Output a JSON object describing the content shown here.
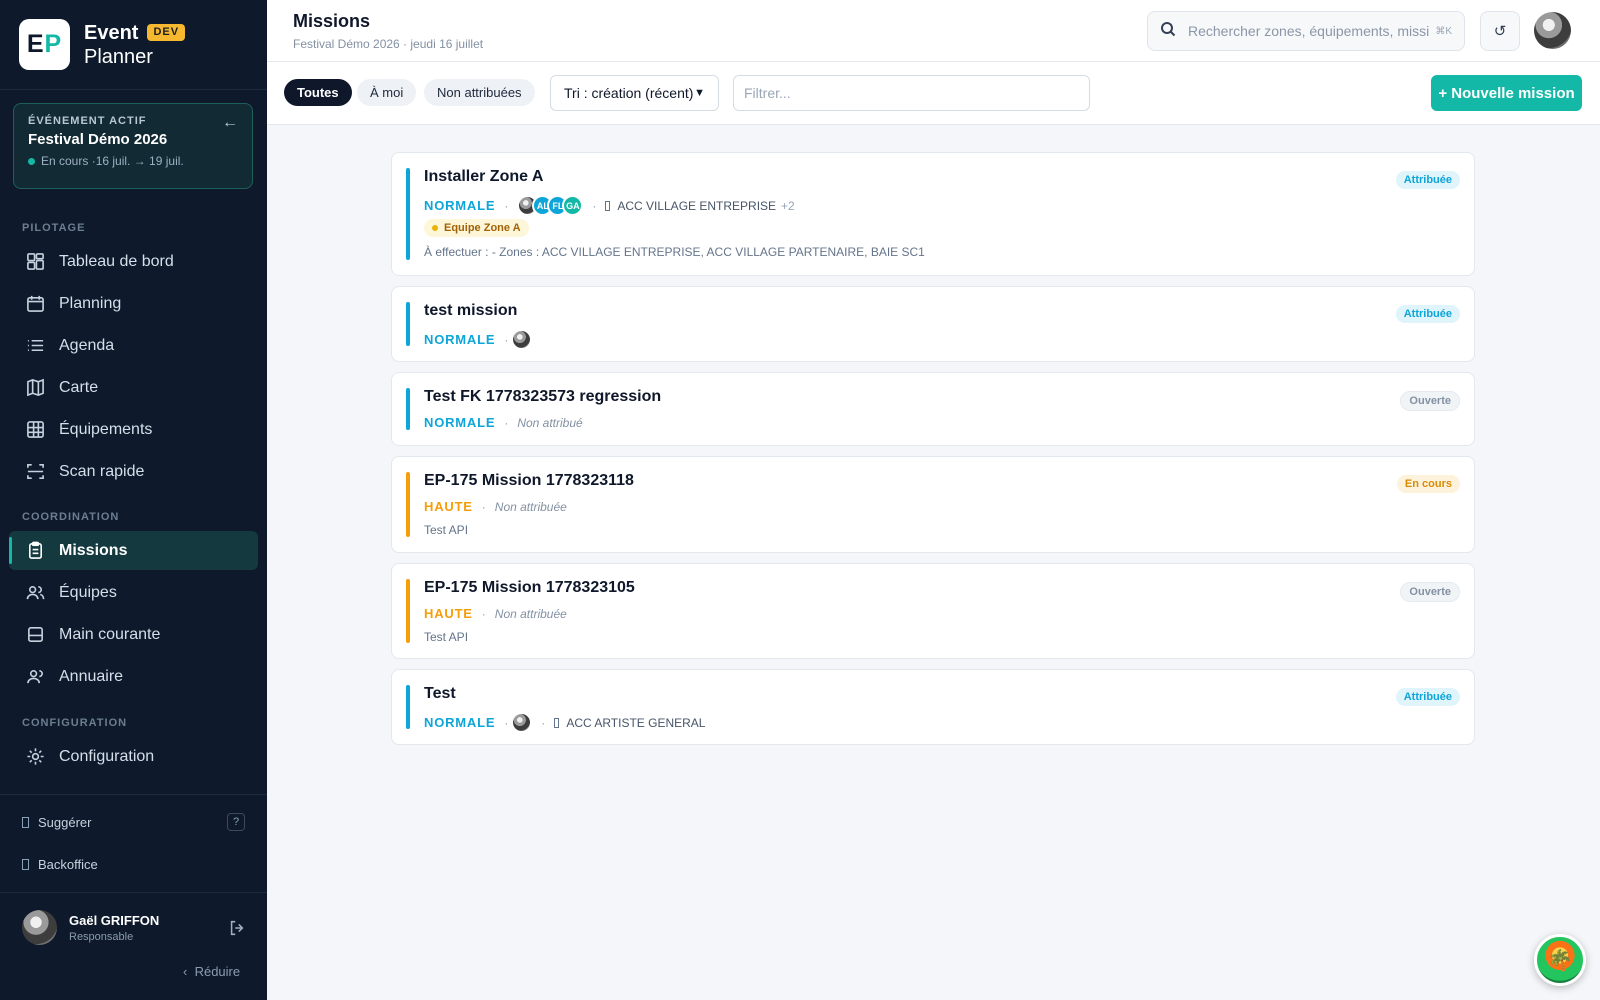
{
  "brand": {
    "logo_e": "E",
    "logo_p": "P",
    "name_top": "Event",
    "name_bottom": "Planner",
    "env_badge": "DEV"
  },
  "active_event": {
    "label": "ÉVÉNEMENT ACTIF",
    "name": "Festival Démo 2026",
    "status": "En cours",
    "dates": "·16 juil. → 19 juil."
  },
  "sidebar": {
    "sections": [
      {
        "label": "PILOTAGE",
        "items": [
          {
            "label": "Tableau de bord",
            "icon": "dashboard-icon"
          },
          {
            "label": "Planning",
            "icon": "calendar-icon"
          },
          {
            "label": "Agenda",
            "icon": "list-icon"
          },
          {
            "label": "Carte",
            "icon": "map-icon"
          },
          {
            "label": "Équipements",
            "icon": "grid-icon"
          },
          {
            "label": "Scan rapide",
            "icon": "scan-icon"
          }
        ]
      },
      {
        "label": "COORDINATION",
        "items": [
          {
            "label": "Missions",
            "icon": "clipboard-icon",
            "active": true
          },
          {
            "label": "Équipes",
            "icon": "users-icon"
          },
          {
            "label": "Main courante",
            "icon": "logbook-icon"
          },
          {
            "label": "Annuaire",
            "icon": "directory-icon"
          }
        ]
      },
      {
        "label": "CONFIGURATION",
        "items": [
          {
            "label": "Configuration",
            "icon": "gear-icon"
          }
        ]
      }
    ],
    "suggest": "Suggérer",
    "help": "?",
    "backoffice": "Backoffice",
    "user": {
      "name": "Gaël GRIFFON",
      "role": "Responsable"
    },
    "collapse": "Réduire"
  },
  "header": {
    "title": "Missions",
    "subtitle": "Festival Démo 2026 · jeudi 16 juillet",
    "search_placeholder": "Rechercher zones, équipements, missi",
    "search_shortcut": "⌘K",
    "refresh": "↺"
  },
  "filters": {
    "tabs": [
      "Toutes",
      "À moi",
      "Non attribuées"
    ],
    "active_tab": "Toutes",
    "sort": "Tri : création (récent)",
    "filter_placeholder": "Filtrer...",
    "new_button": "+ Nouvelle mission"
  },
  "colors": {
    "accent": "#14b8a6",
    "normal": "#0ea5d8",
    "high": "#f59e0b",
    "sidebar_bg": "#0e1a2b"
  },
  "missions": [
    {
      "title": "Installer Zone A",
      "priority": "NORMALE",
      "assignees": [
        "photo",
        "AL",
        "FL",
        "GA"
      ],
      "zone": "ACC VILLAGE ENTREPRISE",
      "zone_extra": "+2",
      "team": "Equipe Zone A",
      "description": "À effectuer : - Zones : ACC VILLAGE ENTREPRISE, ACC VILLAGE PARTENAIRE, BAIE SC1",
      "status": "Attribuée"
    },
    {
      "title": "test mission",
      "priority": "NORMALE",
      "assignees": [
        "photo"
      ],
      "status": "Attribuée"
    },
    {
      "title": "Test FK 1778323573 regression",
      "priority": "NORMALE",
      "unassigned": "Non attribué",
      "status": "Ouverte"
    },
    {
      "title": "EP-175 Mission 1778323118",
      "priority": "HAUTE",
      "unassigned": "Non attribuée",
      "description": "Test API",
      "status": "En cours"
    },
    {
      "title": "EP-175 Mission 1778323105",
      "priority": "HAUTE",
      "unassigned": "Non attribuée",
      "description": "Test API",
      "status": "Ouverte"
    },
    {
      "title": "Test",
      "priority": "NORMALE",
      "assignees": [
        "photo"
      ],
      "zone": "ACC ARTISTE GENERAL",
      "status": "Attribuée"
    }
  ]
}
